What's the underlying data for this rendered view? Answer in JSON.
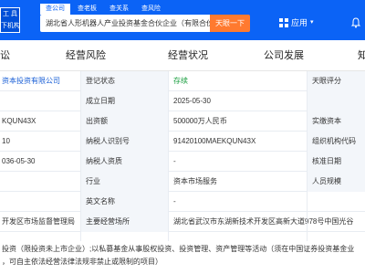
{
  "header": {
    "logo_line1": "工 具",
    "logo_line2": "下机构",
    "nav_tabs": [
      "查公司",
      "查老板",
      "查关系",
      "查风险"
    ],
    "search_value": "湖北省人形机器人产业投资基金合伙企业（有限合伙）",
    "search_button": "天眼一下",
    "app_menu_label": "应用",
    "brand_color": "#0b63f6",
    "accent_color": "#ff7a2f"
  },
  "tabs": [
    "讼",
    "经营风险",
    "经营状况",
    "公司发展",
    "知"
  ],
  "rows": [
    {
      "c0": "资本投资有限公司",
      "c1": "登记状态",
      "c2": "存续",
      "c3": "天眼评分"
    },
    {
      "c0": "",
      "c1": "成立日期",
      "c2": "2025-05-30",
      "c3": ""
    },
    {
      "c0": "KQUN43X",
      "c1": "出资额",
      "c2": "500000万人民币",
      "c3": "实缴资本"
    },
    {
      "c0": "10",
      "c1": "纳税人识别号",
      "c2": "91420100MAEKQUN43X",
      "c3": "组织机构代码"
    },
    {
      "c0": "036-05-30",
      "c1": "纳税人资质",
      "c2": "-",
      "c3": "核准日期"
    },
    {
      "c0": "",
      "c1": "行业",
      "c2": "资本市场服务",
      "c3": "人员规模"
    },
    {
      "c0": "",
      "c1": "英文名称",
      "c2": "-",
      "c3": ""
    },
    {
      "c0": "开发区市场监督管理局",
      "c1": "主要经营场所",
      "c2": "湖北省武汉市东湖新技术开发区高新大道978号中国光谷",
      "c3": ""
    }
  ],
  "note": {
    "line1": "投资（限投资未上市企业）;以私募基金从事股权投资、投资管理、资产管理等活动（须在中国证券投资基金业",
    "line2": "，可自主依法经营法律法规非禁止或限制的项目）"
  }
}
